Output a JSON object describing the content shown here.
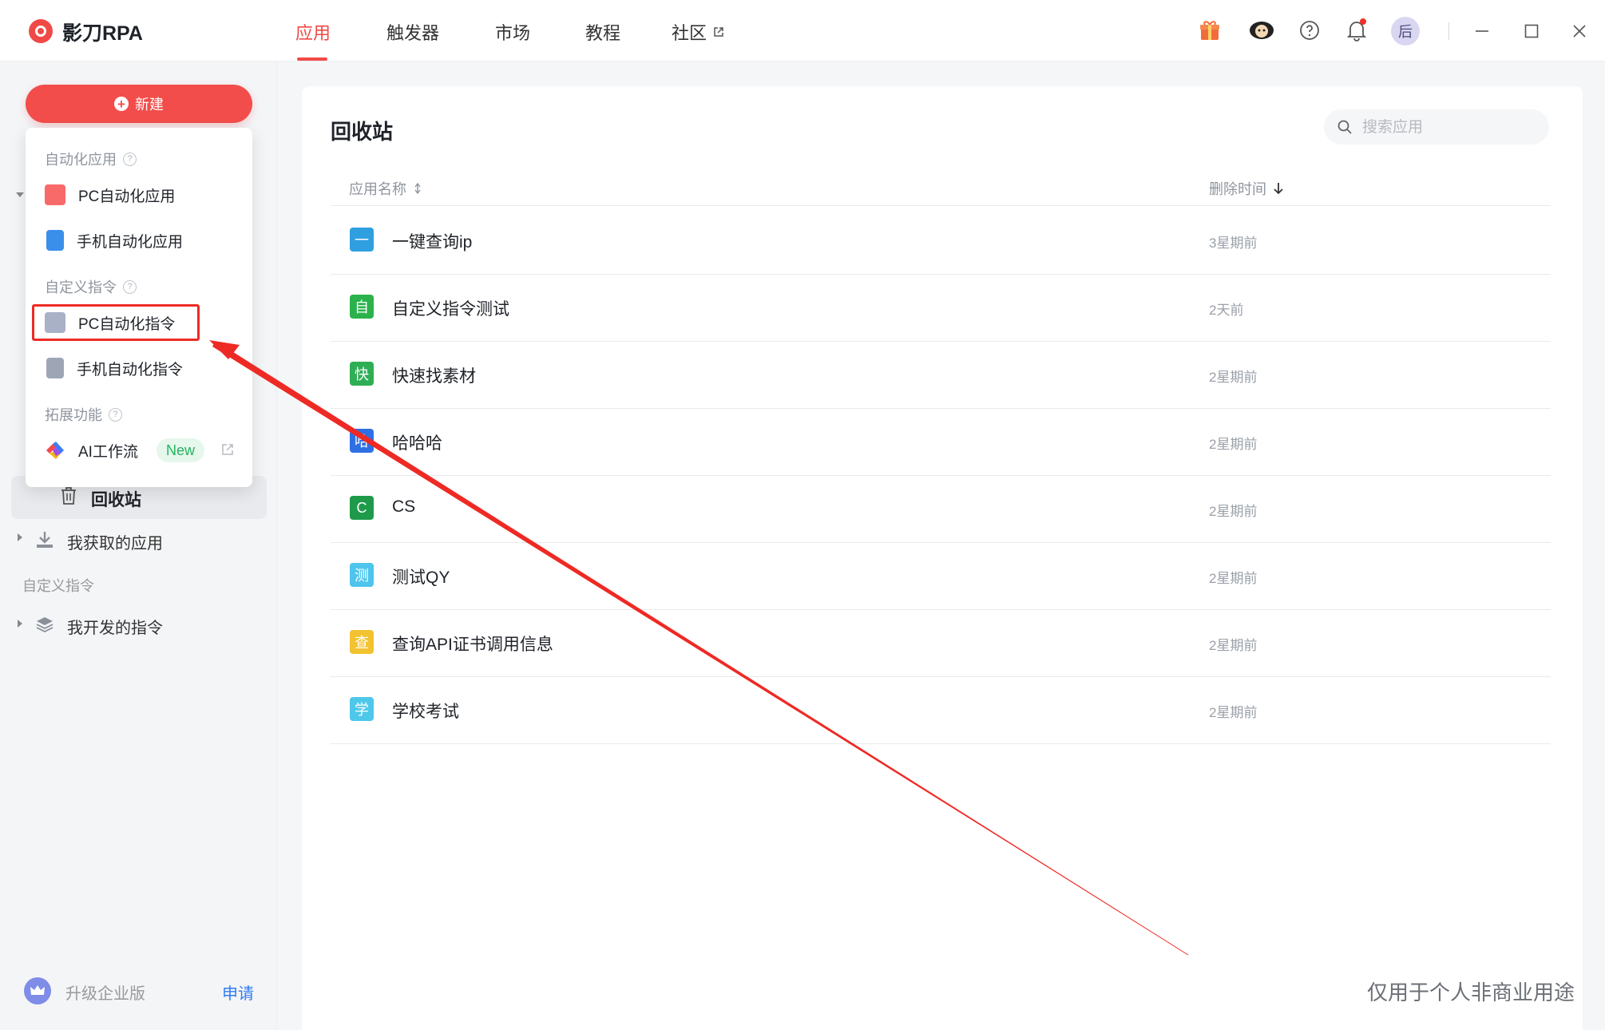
{
  "app": {
    "title": "影刀RPA"
  },
  "nav": [
    "应用",
    "触发器",
    "市场",
    "教程",
    "社区"
  ],
  "user": {
    "avatar_text": "后"
  },
  "sidebar": {
    "new_button": "新建",
    "recycle_label": "回收站",
    "acquired_label": "我获取的应用",
    "custom_section": "自定义指令",
    "my_commands_label": "我开发的指令",
    "upgrade_label": "升级企业版",
    "apply_label": "申请"
  },
  "dropdown": {
    "section_automation": "自动化应用",
    "pc_app": "PC自动化应用",
    "mobile_app": "手机自动化应用",
    "section_custom": "自定义指令",
    "pc_command": "PC自动化指令",
    "mobile_command": "手机自动化指令",
    "section_extend": "拓展功能",
    "ai_workflow": "AI工作流",
    "new_badge": "New"
  },
  "main": {
    "title": "回收站",
    "search_placeholder": "搜索应用",
    "col_name": "应用名称",
    "col_deleted": "删除时间",
    "rows": [
      {
        "badge": "一",
        "color": "#2f9fe0",
        "name": "一键查询ip",
        "time": "3星期前"
      },
      {
        "badge": "自",
        "color": "#2bb24c",
        "name": "自定义指令测试",
        "time": "2天前"
      },
      {
        "badge": "快",
        "color": "#2fae55",
        "name": "快速找素材",
        "time": "2星期前"
      },
      {
        "badge": "哈",
        "color": "#2f6fe4",
        "name": "哈哈哈",
        "time": "2星期前"
      },
      {
        "badge": "C",
        "color": "#1f9a4a",
        "name": "CS",
        "time": "2星期前"
      },
      {
        "badge": "测",
        "color": "#4dc5ec",
        "name": "测试QY",
        "time": "2星期前"
      },
      {
        "badge": "查",
        "color": "#f2c230",
        "name": "查询API证书调用信息",
        "time": "2星期前"
      },
      {
        "badge": "学",
        "color": "#4ec8ea",
        "name": "学校考试",
        "time": "2星期前"
      }
    ]
  },
  "watermark": "仅用于个人非商业用途",
  "colors": {
    "accent": "#f24d4a",
    "annotation": "#ee2a24",
    "link": "#2f7bf5"
  }
}
